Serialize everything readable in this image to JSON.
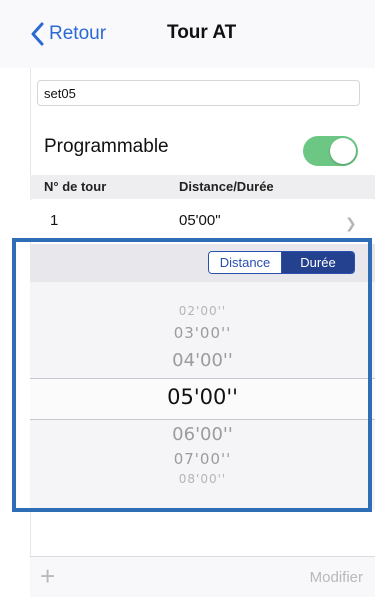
{
  "nav": {
    "back_label": "Retour",
    "title": "Tour AT"
  },
  "form": {
    "name_value": "set05",
    "programmable_label": "Programmable",
    "programmable_on": true
  },
  "table": {
    "headers": [
      "N° de tour",
      "Distance/Durée"
    ],
    "rows": [
      {
        "lap": "1",
        "value": "05'00\""
      }
    ]
  },
  "picker": {
    "segments": [
      "Distance",
      "Durée"
    ],
    "selected_segment": "Durée",
    "items": [
      "02'00''",
      "03'00''",
      "04'00''",
      "05'00''",
      "06'00''",
      "07'00''",
      "08'00''"
    ],
    "selected_value": "05'00''"
  },
  "toolbar": {
    "add_symbol": "+",
    "modify_label": "Modifier"
  },
  "colors": {
    "accent": "#2a6ad3",
    "toggle_on": "#6cc785",
    "segment_active": "#23418f",
    "highlight_frame": "#2f6db5",
    "disabled": "#b8b8bd"
  },
  "icons": {
    "back": "chevron-left-icon",
    "row_disclosure": "chevron-right-icon",
    "add": "plus-icon"
  }
}
